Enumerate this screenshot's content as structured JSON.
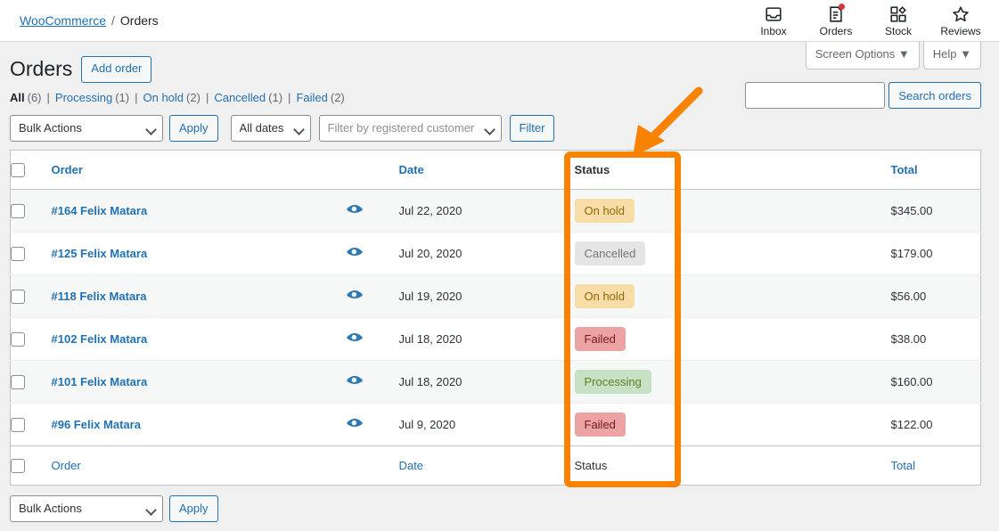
{
  "topbar": {
    "breadcrumb": {
      "parent": "WooCommerce",
      "separator": "/",
      "current": "Orders"
    },
    "nav_items": [
      {
        "label": "Inbox",
        "icon": "inbox-icon",
        "badge": false
      },
      {
        "label": "Orders",
        "icon": "orders-document-icon",
        "badge": true
      },
      {
        "label": "Stock",
        "icon": "stock-grid-icon",
        "badge": false
      },
      {
        "label": "Reviews",
        "icon": "star-icon",
        "badge": false
      }
    ]
  },
  "screen_meta": {
    "screen_options": "Screen Options ▼",
    "help": "Help ▼"
  },
  "header": {
    "title": "Orders",
    "add_order_label": "Add order"
  },
  "status_links": [
    {
      "label": "All",
      "count": "(6)",
      "current": true
    },
    {
      "label": "Processing",
      "count": "(1)",
      "current": false
    },
    {
      "label": "On hold",
      "count": "(2)",
      "current": false
    },
    {
      "label": "Cancelled",
      "count": "(1)",
      "current": false
    },
    {
      "label": "Failed",
      "count": "(2)",
      "current": false
    }
  ],
  "status_link_separator": "|",
  "tablenav_top": {
    "bulk_actions_value": "Bulk Actions",
    "apply_label": "Apply",
    "date_filter_value": "All dates",
    "customer_filter_placeholder": "Filter by registered customer",
    "filter_label": "Filter"
  },
  "search": {
    "input_value": "",
    "placeholder": "",
    "button_label": "Search orders"
  },
  "table": {
    "columns": {
      "order": "Order",
      "date": "Date",
      "status": "Status",
      "total": "Total"
    },
    "rows": [
      {
        "order": "#164 Felix Matara",
        "date": "Jul 22, 2020",
        "status": "On hold",
        "status_class": "status-on-hold",
        "total": "$345.00"
      },
      {
        "order": "#125 Felix Matara",
        "date": "Jul 20, 2020",
        "status": "Cancelled",
        "status_class": "status-cancelled",
        "total": "$179.00"
      },
      {
        "order": "#118 Felix Matara",
        "date": "Jul 19, 2020",
        "status": "On hold",
        "status_class": "status-on-hold",
        "total": "$56.00"
      },
      {
        "order": "#102 Felix Matara",
        "date": "Jul 18, 2020",
        "status": "Failed",
        "status_class": "status-failed",
        "total": "$38.00"
      },
      {
        "order": "#101 Felix Matara",
        "date": "Jul 18, 2020",
        "status": "Processing",
        "status_class": "status-processing",
        "total": "$160.00"
      },
      {
        "order": "#96 Felix Matara",
        "date": "Jul 9, 2020",
        "status": "Failed",
        "status_class": "status-failed",
        "total": "$122.00"
      }
    ]
  },
  "tablenav_bottom": {
    "bulk_actions_value": "Bulk Actions",
    "apply_label": "Apply"
  },
  "annotation": {
    "color": "#f98300",
    "target_column": "Status"
  },
  "colors": {
    "link": "#2271b1",
    "on_hold_bg": "#f8dda7",
    "cancelled_bg": "#e5e5e5",
    "failed_bg": "#eba3a3",
    "processing_bg": "#c6e1c6",
    "annotation": "#f98300"
  }
}
